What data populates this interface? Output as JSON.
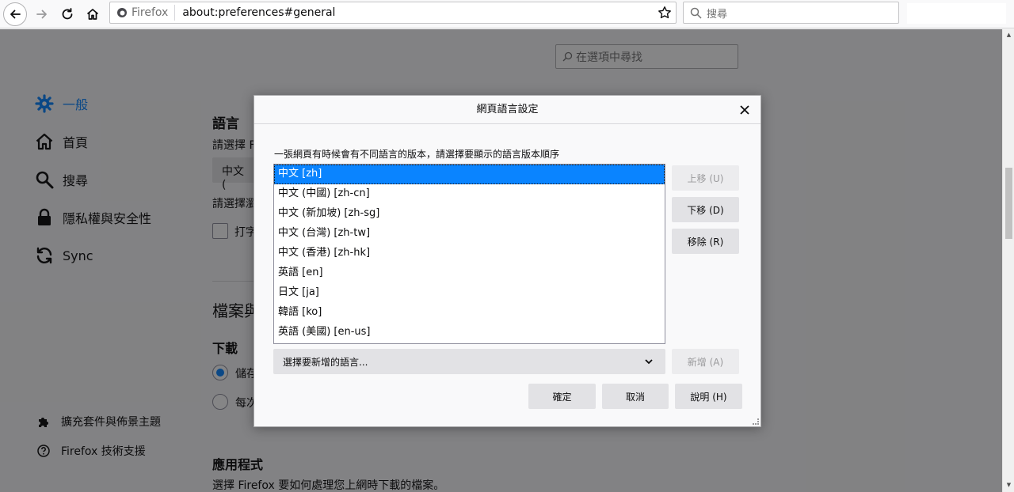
{
  "toolbar": {
    "identity_label": "Firefox",
    "url": "about:preferences#general",
    "search_placeholder": "搜尋"
  },
  "page": {
    "find_placeholder": "在選項中尋找",
    "sidebar": {
      "items": [
        {
          "label": "一般",
          "icon": "gear-icon",
          "active": true
        },
        {
          "label": "首頁",
          "icon": "home-icon"
        },
        {
          "label": "搜尋",
          "icon": "search-icon"
        },
        {
          "label": "隱私權與安全性",
          "icon": "lock-icon"
        },
        {
          "label": "Sync",
          "icon": "sync-icon"
        }
      ],
      "footer": [
        {
          "label": "擴充套件與佈景主題",
          "icon": "puzzle-icon"
        },
        {
          "label": "Firefox 技術支援",
          "icon": "help-icon"
        }
      ]
    },
    "content": {
      "language_heading": "語言",
      "choose_lang_text": "請選擇 F",
      "lang_select_value": "中文 (",
      "choose_web_lang_text": "請選擇瀏",
      "checkbox_label": "打字",
      "files_heading": "檔案與",
      "downloads_heading": "下載",
      "radio_save_label": "儲存",
      "radio_ask_label": "每次",
      "apps_heading": "應用程式",
      "apps_text": "選擇 Firefox 要如何處理您上網時下載的檔案。"
    }
  },
  "dialog": {
    "title": "網頁語言設定",
    "description": "一張網頁有時候會有不同語言的版本，請選擇要顯示的語言版本順序",
    "languages": [
      {
        "label": "中文  [zh]",
        "selected": true
      },
      {
        "label": "中文 (中國)  [zh-cn]"
      },
      {
        "label": "中文 (新加坡)  [zh-sg]"
      },
      {
        "label": "中文 (台灣)  [zh-tw]"
      },
      {
        "label": "中文 (香港)  [zh-hk]"
      },
      {
        "label": "英語  [en]"
      },
      {
        "label": "日文  [ja]"
      },
      {
        "label": "韓語  [ko]"
      },
      {
        "label": "英語 (美國)  [en-us]"
      }
    ],
    "move_up_label": "上移 (U)",
    "move_down_label": "下移 (D)",
    "remove_label": "移除 (R)",
    "add_select_placeholder": "選擇要新增的語言...",
    "add_label": "新增 (A)",
    "ok_label": "確定",
    "cancel_label": "取消",
    "help_label": "說明 (H)"
  }
}
